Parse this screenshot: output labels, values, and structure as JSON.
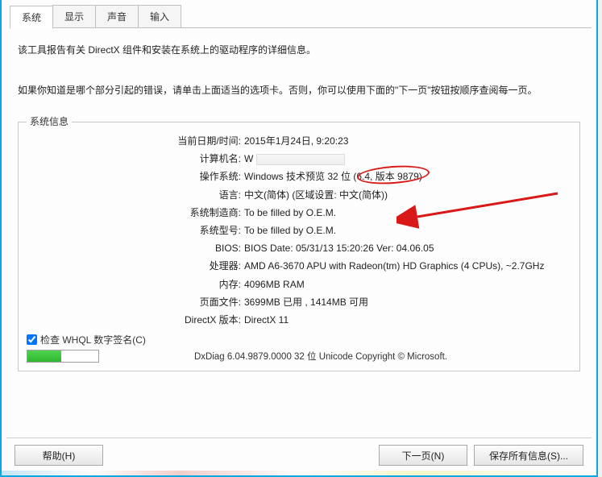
{
  "tabs": {
    "system": "系统",
    "display": "显示",
    "sound": "声音",
    "input": "输入"
  },
  "intro": {
    "line1": "该工具报告有关 DirectX 组件和安装在系统上的驱动程序的详细信息。",
    "line2": "如果你知道是哪个部分引起的错误，请单击上面适当的选项卡。否则，你可以使用下面的\"下一页\"按钮按顺序查阅每一页。"
  },
  "legend": "系统信息",
  "fields": {
    "datetime_label": "当前日期/时间:",
    "datetime_value": "2015年1月24日, 9:20:23",
    "computer_label": "计算机名:",
    "computer_value": "W",
    "os_label": "操作系统:",
    "os_value": "Windows 技术预览 32 位 (6.4, 版本 9879)",
    "lang_label": "语言:",
    "lang_value": "中文(简体) (区域设置: 中文(简体))",
    "mfr_label": "系统制造商:",
    "mfr_value": "To be filled by O.E.M.",
    "model_label": "系统型号:",
    "model_value": "To be filled by O.E.M.",
    "bios_label": "BIOS:",
    "bios_value": "BIOS Date: 05/31/13 15:20:26 Ver: 04.06.05",
    "cpu_label": "处理器:",
    "cpu_value": "AMD A6-3670 APU with Radeon(tm) HD Graphics (4 CPUs), ~2.7GHz",
    "mem_label": "内存:",
    "mem_value": "4096MB RAM",
    "page_label": "页面文件:",
    "page_value": "3699MB 已用 , 1414MB 可用",
    "dx_label": "DirectX 版本:",
    "dx_value": "DirectX 11"
  },
  "checkbox_label": "检查 WHQL 数字签名(C)",
  "copyright": "DxDiag 6.04.9879.0000 32 位 Unicode  Copyright © Microsoft.",
  "buttons": {
    "help": "帮助(H)",
    "next": "下一页(N)",
    "save": "保存所有信息(S)..."
  },
  "annotations": {
    "highlight_build": "版本 9879"
  }
}
